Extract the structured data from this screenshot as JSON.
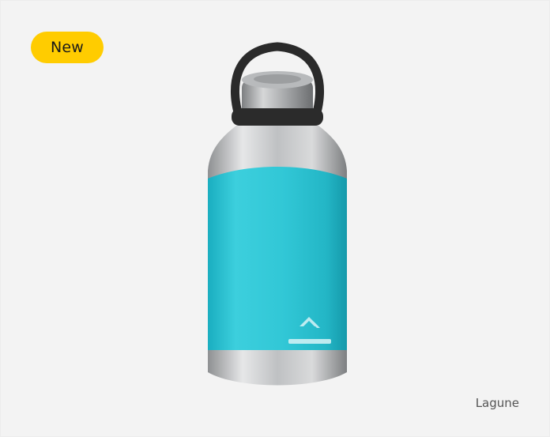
{
  "product_card": {
    "badge_label": "New",
    "image": {
      "subject": "insulated-bottle-icon",
      "colors": {
        "body": "#2fc4d3",
        "steel": "#c9cbcc",
        "handle": "#2a2a2a"
      }
    },
    "color_name": "Lagune"
  }
}
